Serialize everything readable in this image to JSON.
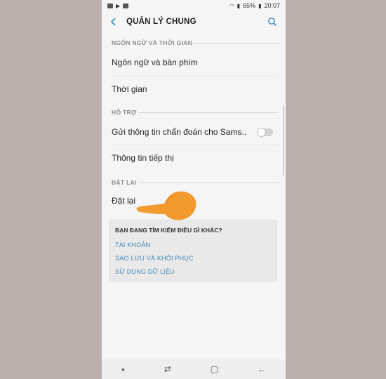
{
  "status_bar": {
    "battery": "65%",
    "time": "20:07",
    "icons": [
      "image-icon",
      "play-icon",
      "youtube-icon",
      "wifi-icon",
      "signal-icon",
      "battery-icon"
    ]
  },
  "header": {
    "title": "QUẢN LÝ CHUNG"
  },
  "sections": [
    {
      "label": "NGÔN NGỮ VÀ THỜI GIAN",
      "items": [
        "Ngôn ngữ và bàn phím",
        "Thời gian"
      ]
    },
    {
      "label": "HỖ TRỢ",
      "items": [
        "Gửi thông tin chẩn đoán cho Sams..",
        "Thông tin tiếp thị"
      ]
    },
    {
      "label": "ĐẶT LẠI",
      "items": [
        "Đặt lại"
      ]
    }
  ],
  "suggest": {
    "title": "BẠN ĐANG TÌM KIẾM ĐIỀU GÌ KHÁC?",
    "links": [
      "TÀI KHOẢN",
      "SAO LƯU VÀ KHÔI PHỤC",
      "SỬ DỤNG DỮ LIỆU"
    ]
  },
  "colors": {
    "accent": "#3f86b8",
    "background": "#b9b0ae",
    "hand": "#f29a2e"
  }
}
